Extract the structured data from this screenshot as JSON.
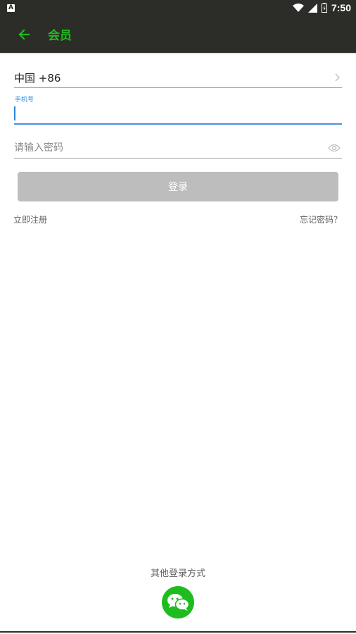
{
  "status_bar": {
    "notification_letter": "A",
    "time": "7:50"
  },
  "toolbar": {
    "title": "会员"
  },
  "form": {
    "country": "中国 +86",
    "phone_label": "手机号",
    "phone_value": "",
    "password_placeholder": "请输入密码",
    "login_label": "登录"
  },
  "links": {
    "register": "立即注册",
    "forgot": "忘记密码？"
  },
  "other_login": {
    "label": "其他登录方式"
  },
  "colors": {
    "toolbar_bg": "#2c2c28",
    "accent_green": "#1eba1e",
    "focus_blue": "#4a90e2",
    "disabled_button": "#bdbdbd"
  },
  "icons": [
    "back-arrow-icon",
    "chevron-right-icon",
    "eye-icon",
    "wechat-icon",
    "wifi-icon",
    "signal-icon",
    "battery-icon"
  ]
}
